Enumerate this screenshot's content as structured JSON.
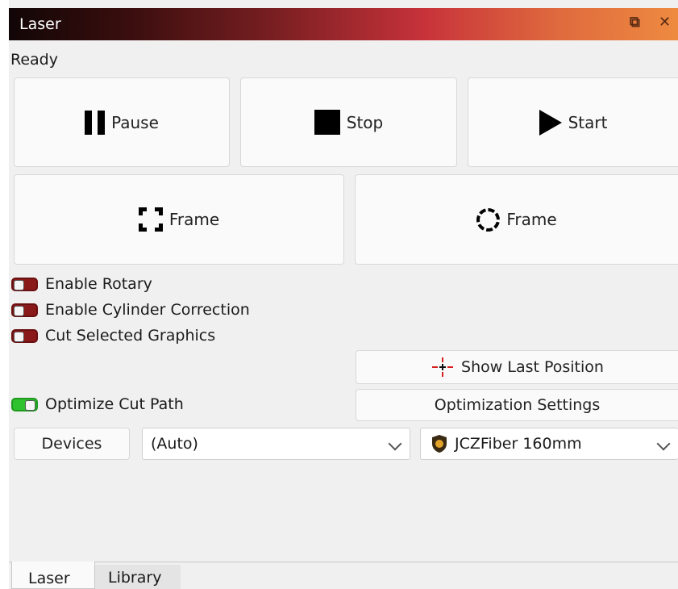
{
  "window": {
    "title": "Laser",
    "restore_icon": "restore-window-icon",
    "close_icon": "close-icon"
  },
  "status": "Ready",
  "buttons": {
    "pause": "Pause",
    "stop": "Stop",
    "start": "Start",
    "frame_rect": "Frame",
    "frame_circle": "Frame",
    "show_last_position": "Show Last Position",
    "optimization_settings": "Optimization Settings",
    "devices": "Devices"
  },
  "toggles": [
    {
      "label": "Enable Rotary",
      "on": false
    },
    {
      "label": "Enable Cylinder Correction",
      "on": false
    },
    {
      "label": "Cut Selected Graphics",
      "on": false
    },
    {
      "label": "Optimize Cut Path",
      "on": true
    }
  ],
  "combos": {
    "port": "(Auto)",
    "device": "JCZFiber 160mm"
  },
  "tabs": [
    {
      "label": "Laser",
      "active": true
    },
    {
      "label": "Library",
      "active": false
    }
  ],
  "colors": {
    "toggle_off": "#8a1a1a",
    "toggle_on": "#2ec22e",
    "crosshair": "#d81e1e"
  }
}
